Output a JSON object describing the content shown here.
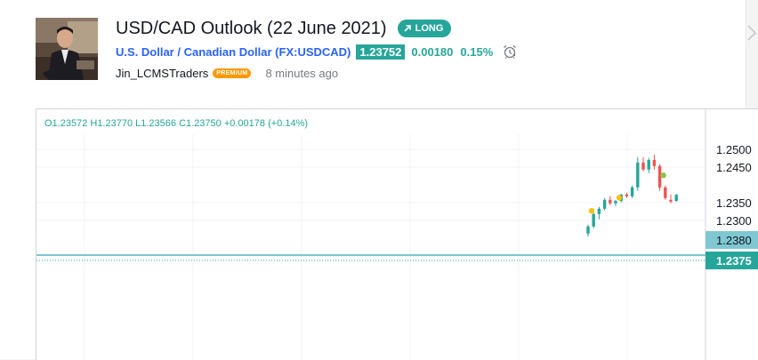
{
  "idea": {
    "title": "USD/CAD Outlook (22 June 2021)",
    "direction_label": "LONG",
    "symbol_name": "U.S. Dollar / Canadian Dollar",
    "symbol_code": "(FX:USDCAD)",
    "price": "1.23752",
    "change": "0.00180",
    "change_pct": "0.15%",
    "author": "Jin_LCMSTraders",
    "author_badge": "PREMIUM",
    "time_ago": "8 minutes ago"
  },
  "chart": {
    "ohlc": "O1.23572 H1.23770 L1.23566 C1.23750 +0.00178 (+0.14%)",
    "axis_labels": [
      "1.2500",
      "1.2450",
      "1.2350",
      "1.2300"
    ],
    "tag_level": "1.2380",
    "tag_price": "1.2375",
    "colors": {
      "up": "#26a69a",
      "down": "#ef5350",
      "level": "#7fc8d2",
      "price": "#26a69a"
    }
  },
  "chart_data": {
    "type": "candlestick",
    "y_ticks": [
      1.25,
      1.245,
      1.235,
      1.23
    ],
    "horizontal_level": 1.238,
    "last_price": 1.2375,
    "candles": [
      {
        "o": 1.2263,
        "h": 1.2288,
        "l": 1.2255,
        "c": 1.2283
      },
      {
        "o": 1.2283,
        "h": 1.2323,
        "l": 1.2278,
        "c": 1.2318
      },
      {
        "o": 1.2318,
        "h": 1.2338,
        "l": 1.2303,
        "c": 1.2333
      },
      {
        "o": 1.2333,
        "h": 1.2363,
        "l": 1.2328,
        "c": 1.2358
      },
      {
        "o": 1.2358,
        "h": 1.2368,
        "l": 1.2343,
        "c": 1.2348
      },
      {
        "o": 1.2348,
        "h": 1.2358,
        "l": 1.234,
        "c": 1.2355
      },
      {
        "o": 1.2355,
        "h": 1.2375,
        "l": 1.235,
        "c": 1.2373
      },
      {
        "o": 1.2373,
        "h": 1.2378,
        "l": 1.2363,
        "c": 1.2368
      },
      {
        "o": 1.2368,
        "h": 1.2398,
        "l": 1.2363,
        "c": 1.2393
      },
      {
        "o": 1.2393,
        "h": 1.2478,
        "l": 1.2383,
        "c": 1.2463
      },
      {
        "o": 1.2463,
        "h": 1.2478,
        "l": 1.2438,
        "c": 1.2443
      },
      {
        "o": 1.2443,
        "h": 1.2476,
        "l": 1.2433,
        "c": 1.247
      },
      {
        "o": 1.247,
        "h": 1.2485,
        "l": 1.2443,
        "c": 1.2453
      },
      {
        "o": 1.2453,
        "h": 1.2458,
        "l": 1.2383,
        "c": 1.2393
      },
      {
        "o": 1.2393,
        "h": 1.2398,
        "l": 1.2358,
        "c": 1.2363
      },
      {
        "o": 1.2358,
        "h": 1.2373,
        "l": 1.2348,
        "c": 1.2353
      },
      {
        "o": 1.2355,
        "h": 1.2375,
        "l": 1.2352,
        "c": 1.2372
      }
    ],
    "markers": [
      {
        "candle": 0,
        "price": 1.2327,
        "color": "#ffc107"
      },
      {
        "candle": 5,
        "price": 1.2364,
        "color": "#ffc107"
      },
      {
        "candle": 13,
        "price": 1.2427,
        "color": "#8bc34a"
      }
    ]
  }
}
